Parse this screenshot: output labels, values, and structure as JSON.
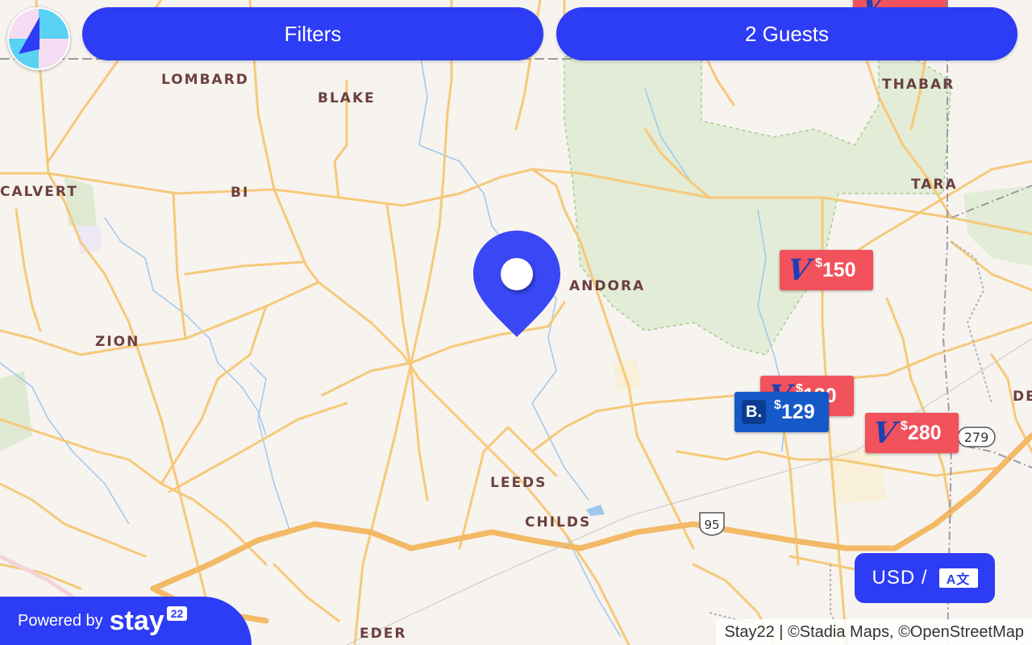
{
  "header": {
    "filters_label": "Filters",
    "guests_label": "2 Guests"
  },
  "logo": {
    "icon": "stay22-logo-icon"
  },
  "places": {
    "lombard": "LOMBARD",
    "blake": "BLAKE",
    "thabar": "THABAR",
    "calvert": "CALVERT",
    "bi": "BI",
    "tara": "TARA",
    "andora": "ANDORA",
    "zion": "ZION",
    "de": "DE",
    "leeds": "LEEDS",
    "childs": "CHILDS",
    "eder": "EDER"
  },
  "highways": {
    "i95": "95",
    "r279": "279"
  },
  "listings": [
    {
      "provider": "vrbo",
      "price": "$150",
      "currency_symbol": "$",
      "amount": "150"
    },
    {
      "provider": "vrbo",
      "price": "$130",
      "currency_symbol": "$",
      "amount": "130"
    },
    {
      "provider": "booking",
      "price": "$129",
      "currency_symbol": "$",
      "amount": "129",
      "logo_letter": "B."
    },
    {
      "provider": "vrbo",
      "price": "$280",
      "currency_symbol": "$",
      "amount": "280"
    }
  ],
  "currency_button": {
    "label": "USD /",
    "translate_icon": "translate-icon",
    "icon_text": "A文"
  },
  "footer": {
    "powered_by": "Powered by",
    "brand": "stay",
    "brand_badge": "22"
  },
  "attribution": "Stay22 | ©Stadia Maps, ©OpenStreetMap",
  "colors": {
    "accent": "#2d3cf5",
    "vrbo": "#f2525b",
    "booking": "#1559c8",
    "road": "#f6c97a",
    "park": "#e3ecd6",
    "water": "#9ec8ee",
    "land": "#f7f3ef"
  }
}
